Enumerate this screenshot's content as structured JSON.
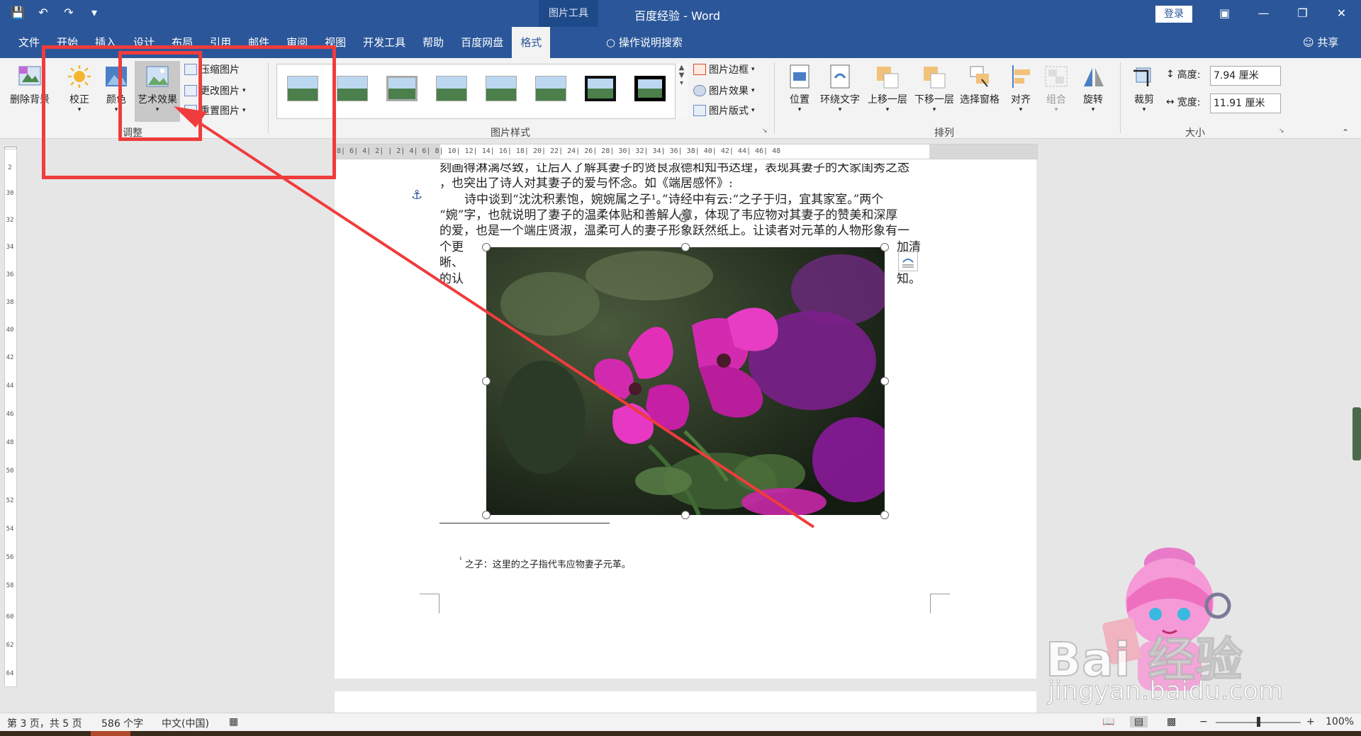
{
  "titlebar": {
    "context_tab": "图片工具",
    "doc_title": "百度经验 - Word",
    "login": "登录",
    "qat_icons": [
      "save-icon",
      "undo-icon",
      "redo-icon",
      "customize-icon"
    ],
    "window_icons": [
      "ribbon-display-icon",
      "minimize-icon",
      "restore-icon",
      "close-icon"
    ]
  },
  "tabs": [
    {
      "label": "文件"
    },
    {
      "label": "开始"
    },
    {
      "label": "插入"
    },
    {
      "label": "设计"
    },
    {
      "label": "布局"
    },
    {
      "label": "引用"
    },
    {
      "label": "邮件"
    },
    {
      "label": "审阅"
    },
    {
      "label": "视图"
    },
    {
      "label": "开发工具"
    },
    {
      "label": "帮助"
    },
    {
      "label": "百度网盘"
    },
    {
      "label": "格式",
      "active": true
    }
  ],
  "tellme": "操作说明搜索",
  "share": "共享",
  "ribbon": {
    "adjust": {
      "remove_bg": "删除背景",
      "corrections": "校正",
      "color": "颜色",
      "artistic": "艺术效果",
      "compress": "压缩图片",
      "change": "更改图片",
      "reset": "重置图片",
      "label": "调整"
    },
    "styles": {
      "border": "图片边框",
      "effects": "图片效果",
      "layout": "图片版式",
      "label": "图片样式"
    },
    "arrange": {
      "position": "位置",
      "wrap": "环绕文字",
      "forward": "上移一层",
      "backward": "下移一层",
      "pane": "选择窗格",
      "align": "对齐",
      "group": "组合",
      "rotate": "旋转",
      "label": "排列"
    },
    "size": {
      "crop": "裁剪",
      "height_label": "高度:",
      "height_value": "7.94 厘米",
      "width_label": "宽度:",
      "width_value": "11.91 厘米",
      "label": "大小"
    }
  },
  "ruler": {
    "h": "8|  6|  4|  2|     |  2|  4|  6|  8|  10|  12|  14|  16|  18|  20|  22|  24|  26|  28|  30|  32|  34|  36|  38|  40|  42|  44|  46|  48",
    "v": [
      "2",
      "30",
      "32",
      "34",
      "36",
      "38",
      "40",
      "42",
      "44",
      "46",
      "48",
      "50",
      "52",
      "54",
      "56",
      "58",
      "60",
      "62",
      "64"
    ]
  },
  "document": {
    "line0": "刻画得淋漓尽致，让后人了解其妻子的贤良淑德和知书达理，表现其妻子的大家闺秀之态",
    "line1": "，也突出了诗人对其妻子的爱与怀念。如《端居感怀》:",
    "line2": "诗中谈到“沈沈积素饱，婉婉属之子¹。”诗经中有云:“之子于归，宜其家室。”两个",
    "line3": "“婉”字，也就说明了妻子的温柔体贴和善解人意，体现了韦应物对其妻子的赞美和深厚",
    "line4": "的爱，也是一个端庄贤淑，温柔可人的妻子形象跃然纸上。让读者对元革的人物形象有一",
    "wrap_l1": "个更",
    "wrap_l2": "晰、",
    "wrap_l3": "的认",
    "wrap_r1": "加清",
    "wrap_r3": "知。",
    "footnote_mark": "¹",
    "footnote": "之子：这里的之子指代韦应物妻子元革。"
  },
  "status": {
    "page": "第 3 页，共 5 页",
    "words": "586 个字",
    "lang": "中文(中国)",
    "zoom": "100%",
    "view_icons": [
      "read-mode-icon",
      "print-layout-icon",
      "web-layout-icon"
    ]
  },
  "watermark": {
    "brand": "Bai 经验",
    "url": "jingyan.baidu.com"
  },
  "colors": {
    "accent": "#2b579a",
    "annotation": "#f03c3c"
  }
}
